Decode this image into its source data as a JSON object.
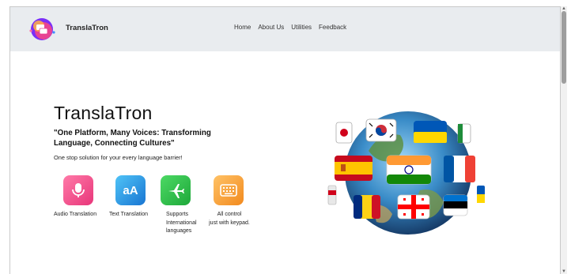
{
  "header": {
    "brand": "TranslaTron",
    "nav": [
      "Home",
      "About Us",
      "Utilities",
      "Feedback"
    ]
  },
  "hero": {
    "title": "TranslaTron",
    "tagline": "\"One Platform, Many Voices: Transforming Language, Connecting Cultures\"",
    "subtext": "One stop solution for your every language barrier!"
  },
  "features": [
    {
      "label": [
        "Audio Translation"
      ],
      "icon": "microphone-icon",
      "color": "#e8367a"
    },
    {
      "label": [
        "Text Translation"
      ],
      "icon": "text-aa-icon",
      "color": "#1976d2"
    },
    {
      "label": [
        "Supports",
        "International",
        "languages"
      ],
      "icon": "airplane-icon",
      "color": "#1ea83a"
    },
    {
      "label": [
        "All control",
        "just with keypad."
      ],
      "icon": "keyboard-icon",
      "color": "#f28a1e"
    }
  ],
  "icon_text": "aA",
  "colors": {
    "navbar": "#e9ecef",
    "accent": "#d63384"
  }
}
